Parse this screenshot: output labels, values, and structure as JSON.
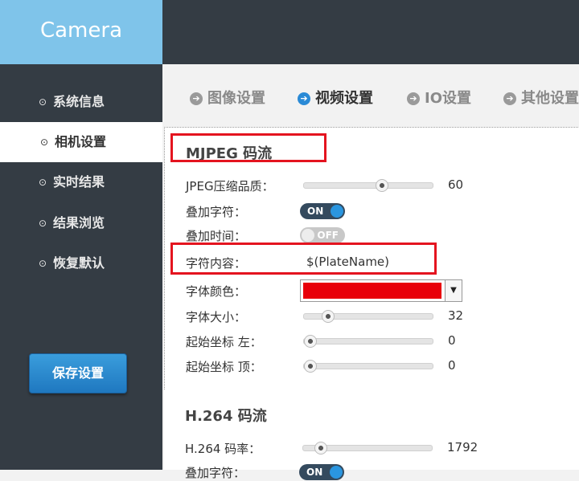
{
  "app": {
    "title": "Camera"
  },
  "sidebar": {
    "items": [
      {
        "label": "系统信息",
        "active": false
      },
      {
        "label": "相机设置",
        "active": true
      },
      {
        "label": "实时结果",
        "active": false
      },
      {
        "label": "结果浏览",
        "active": false
      },
      {
        "label": "恢复默认",
        "active": false
      }
    ],
    "bullet": "⊙",
    "save_label": "保存设置"
  },
  "tabs": [
    {
      "label": "图像设置",
      "active": false
    },
    {
      "label": "视频设置",
      "active": true
    },
    {
      "label": "IO设置",
      "active": false
    },
    {
      "label": "其他设置",
      "active": false
    }
  ],
  "mjpeg": {
    "heading": "MJPEG 码流",
    "quality": {
      "label": "JPEG压缩品质：",
      "value": "60",
      "level": 0.6
    },
    "overlay_text": {
      "label": "叠加字符：",
      "state": "ON"
    },
    "overlay_time": {
      "label": "叠加时间：",
      "state": "OFF"
    },
    "char_content": {
      "label": "字符内容：",
      "value": "$(PlateName)"
    },
    "font_color": {
      "label": "字体颜色：",
      "color": "#e8000a"
    },
    "font_size": {
      "label": "字体大小：",
      "value": "32",
      "level": 0.2
    },
    "start_left": {
      "label": "起始坐标 左：",
      "value": "0",
      "level": 0
    },
    "start_top": {
      "label": "起始坐标 顶：",
      "value": "0",
      "level": 0
    }
  },
  "h264": {
    "heading": "H.264 码流",
    "bitrate": {
      "label": "H.264 码率：",
      "value": "1792",
      "level": 0.12
    },
    "overlay_text": {
      "label": "叠加字符：",
      "state": "ON"
    }
  },
  "colors": {
    "accent": "#2a8ad6",
    "brand_bg": "#7fc4ea",
    "dark_bg": "#343c44",
    "highlight": "#e4141f"
  }
}
